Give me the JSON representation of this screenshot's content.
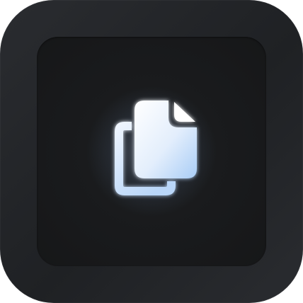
{
  "app_icon": {
    "icon": "copy-files-icon",
    "colors": {
      "outer_frame": "#26282b",
      "inner_plate": "#1a1b1d",
      "glyph_top": "#ffffff",
      "glyph_bottom": "#a9cdf6",
      "glyph_outline": "#dce9fb"
    }
  }
}
